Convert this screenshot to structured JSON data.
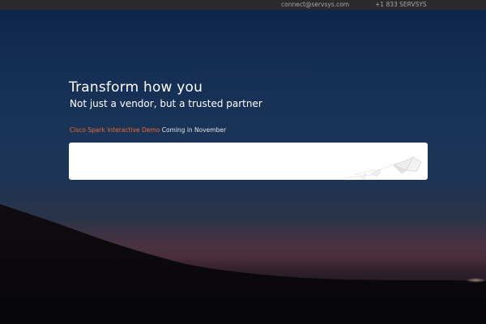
{
  "topbar": {
    "email": "connect@servsys.com",
    "phone": "+1 833 SERVSYS"
  },
  "hero": {
    "headline": "Transform how you",
    "subheadline": "Not just a vendor, but a trusted partner"
  },
  "announcement": {
    "link_label": "Cisco Spark Interactive Demo",
    "text": " Coming in November"
  },
  "colors": {
    "accent": "#ef6a2c",
    "topbar": "#2b2b2b",
    "sky": "#1a3458"
  }
}
